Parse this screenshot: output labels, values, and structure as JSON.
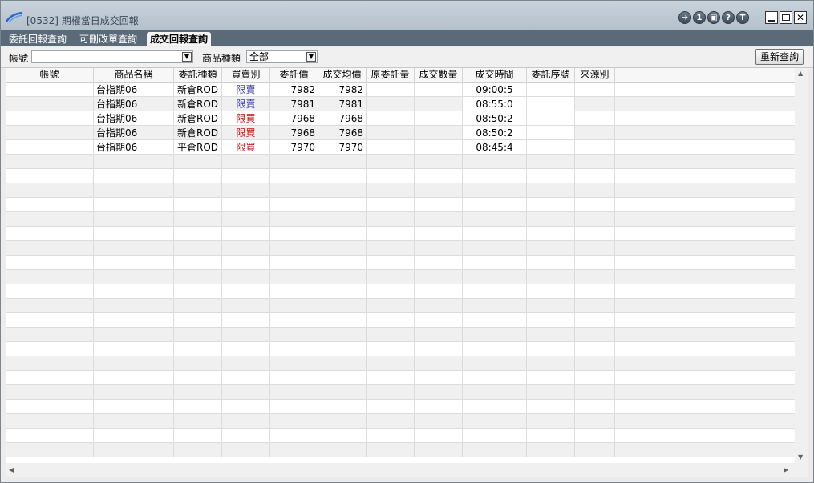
{
  "window": {
    "title": "[0532] 期權當日成交回報"
  },
  "titlebar_icons": [
    "export-icon",
    "one-icon",
    "print-icon",
    "help-icon",
    "t-icon"
  ],
  "titlebar_icon_glyphs": [
    "➔",
    "1",
    "▣",
    "?",
    "T"
  ],
  "tabs": [
    {
      "label": "委託回報查詢"
    },
    {
      "label": "可刪改單查詢"
    },
    {
      "label": "成交回報查詢"
    }
  ],
  "toolbar": {
    "account_label": "帳號",
    "account_value": "",
    "product_type_label": "商品種類",
    "product_type_value": "全部",
    "requery_label": "重新查詢"
  },
  "table": {
    "columns": [
      "帳號",
      "商品名稱",
      "委託種類",
      "買賣別",
      "委託價",
      "成交均價",
      "原委託量",
      "成交數量",
      "成交時間",
      "委託序號",
      "來源別"
    ],
    "rows": [
      {
        "account": "",
        "product": "台指期06",
        "order_type": "新倉ROD",
        "side": "限賣",
        "price": "7982",
        "avg_price": "7982",
        "orig_qty": "",
        "filled_qty": "",
        "time": "09:00:5",
        "order_no": "",
        "source": ""
      },
      {
        "account": "",
        "product": "台指期06",
        "order_type": "新倉ROD",
        "side": "限賣",
        "price": "7981",
        "avg_price": "7981",
        "orig_qty": "",
        "filled_qty": "",
        "time": "08:55:0",
        "order_no": "",
        "source": ""
      },
      {
        "account": "",
        "product": "台指期06",
        "order_type": "新倉ROD",
        "side": "限買",
        "price": "7968",
        "avg_price": "7968",
        "orig_qty": "",
        "filled_qty": "",
        "time": "08:50:2",
        "order_no": "",
        "source": ""
      },
      {
        "account": "",
        "product": "台指期06",
        "order_type": "新倉ROD",
        "side": "限買",
        "price": "7968",
        "avg_price": "7968",
        "orig_qty": "",
        "filled_qty": "",
        "time": "08:50:2",
        "order_no": "",
        "source": ""
      },
      {
        "account": "",
        "product": "台指期06",
        "order_type": "平倉ROD",
        "side": "限買",
        "price": "7970",
        "avg_price": "7970",
        "orig_qty": "",
        "filled_qty": "",
        "time": "08:45:4",
        "order_no": "",
        "source": ""
      }
    ],
    "empty_rows": 21
  },
  "colors": {
    "sell": "#3b3bb0",
    "buy": "#c01010",
    "tab_bar": "#5a6a78",
    "title_bar": "#c0cbd5"
  }
}
